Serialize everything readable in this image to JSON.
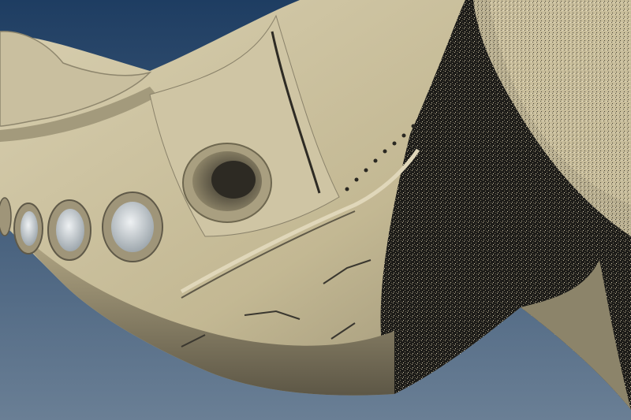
{
  "scene": {
    "kind": "3d-render",
    "subject": "spaceship-hull-closeup",
    "colors": {
      "sky_top": "#1e3d62",
      "sky_bottom": "#6a7f95",
      "hull_light": "#d2c8a8",
      "hull_mid": "#b3a785",
      "hull_dark": "#6c6550",
      "shadow": "#1d1c19",
      "porthole_rim": "#9f9579",
      "porthole_glass": "#d9dde0"
    }
  }
}
